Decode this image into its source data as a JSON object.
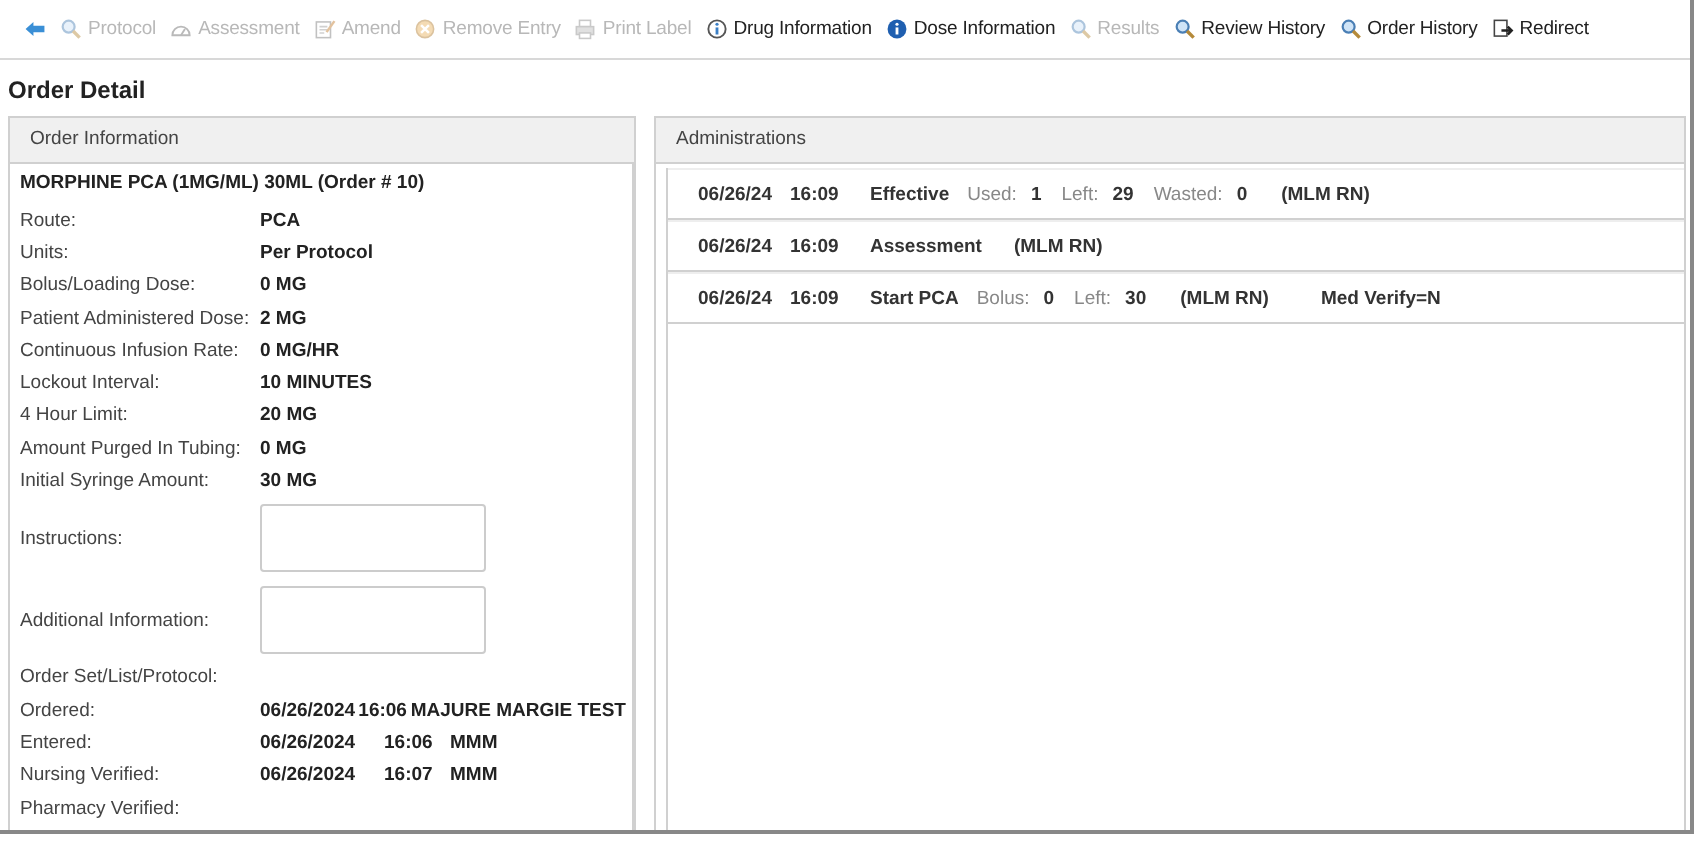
{
  "toolbar": [
    {
      "kind": "back",
      "disabled": false
    },
    {
      "kind": "search",
      "label": "Protocol",
      "disabled": true
    },
    {
      "kind": "gauge",
      "label": "Assessment",
      "disabled": true
    },
    {
      "kind": "note",
      "label": "Amend",
      "disabled": true
    },
    {
      "kind": "remove",
      "label": "Remove Entry",
      "disabled": true
    },
    {
      "kind": "printer",
      "label": "Print Label",
      "disabled": true
    },
    {
      "kind": "info-outline",
      "label": "Drug Information",
      "disabled": false
    },
    {
      "kind": "info",
      "label": "Dose Information",
      "disabled": false
    },
    {
      "kind": "search",
      "label": "Results",
      "disabled": true
    },
    {
      "kind": "search",
      "label": "Review History",
      "disabled": false
    },
    {
      "kind": "search",
      "label": "Order History",
      "disabled": false
    },
    {
      "kind": "redirect",
      "label": "Redirect",
      "disabled": false
    }
  ],
  "title": "Order Detail",
  "order_panel": {
    "header": "Order Information",
    "drug": "MORPHINE PCA (1MG/ML) 30ML (Order # 10)",
    "fields": [
      {
        "kind": "text",
        "label": "Route:",
        "value": "PCA"
      },
      {
        "kind": "text",
        "label": "Units:",
        "value": "Per Protocol"
      },
      {
        "kind": "text",
        "label": "Bolus/Loading Dose:",
        "value": "0 MG"
      },
      {
        "kind": "text",
        "label": "Patient Administered Dose:",
        "value": "2 MG"
      },
      {
        "kind": "text",
        "label": "Continuous Infusion Rate:",
        "value": "0 MG/HR"
      },
      {
        "kind": "text",
        "label": "Lockout Interval:",
        "value": "10 MINUTES"
      },
      {
        "kind": "text",
        "label": "4 Hour Limit:",
        "value": "20 MG"
      },
      {
        "kind": "text",
        "label": "Amount Purged In Tubing:",
        "value": "0 MG"
      },
      {
        "kind": "text",
        "label": "Initial Syringe Amount:",
        "value": "30 MG"
      },
      {
        "kind": "box",
        "label": "Instructions:"
      },
      {
        "kind": "box",
        "label": "Additional Information:"
      },
      {
        "kind": "text",
        "label": "Order Set/List/Protocol:"
      }
    ],
    "events": [
      {
        "label": "Ordered:",
        "date": "06/26/2024",
        "time": "16:06",
        "user": "MAJURE MARGIE TEST"
      },
      {
        "label": "Entered:",
        "date": "06/26/2024",
        "time": "16:06",
        "user": "MMM"
      },
      {
        "label": "Nursing Verified:",
        "date": "06/26/2024",
        "time": "16:07",
        "user": "MMM"
      },
      {
        "label": "Pharmacy Verified:"
      }
    ]
  },
  "administrations": {
    "header": "Administrations",
    "rows": [
      {
        "date": "06/26/24",
        "time": "16:09",
        "type": "Effective",
        "details": [
          {
            "label": "Used:",
            "value": "1"
          },
          {
            "label": "Left:",
            "value": "29"
          },
          {
            "label": "Wasted:",
            "value": "0"
          }
        ],
        "user": "(MLM RN)"
      },
      {
        "date": "06/26/24",
        "time": "16:09",
        "type": "Assessment",
        "user": "(MLM RN)"
      },
      {
        "date": "06/26/24",
        "time": "16:09",
        "type": "Start PCA",
        "details": [
          {
            "label": "Bolus:",
            "value": "0"
          },
          {
            "label": "Left:",
            "value": "30"
          }
        ],
        "user": "(MLM RN)",
        "note": "Med Verify=N"
      }
    ]
  }
}
